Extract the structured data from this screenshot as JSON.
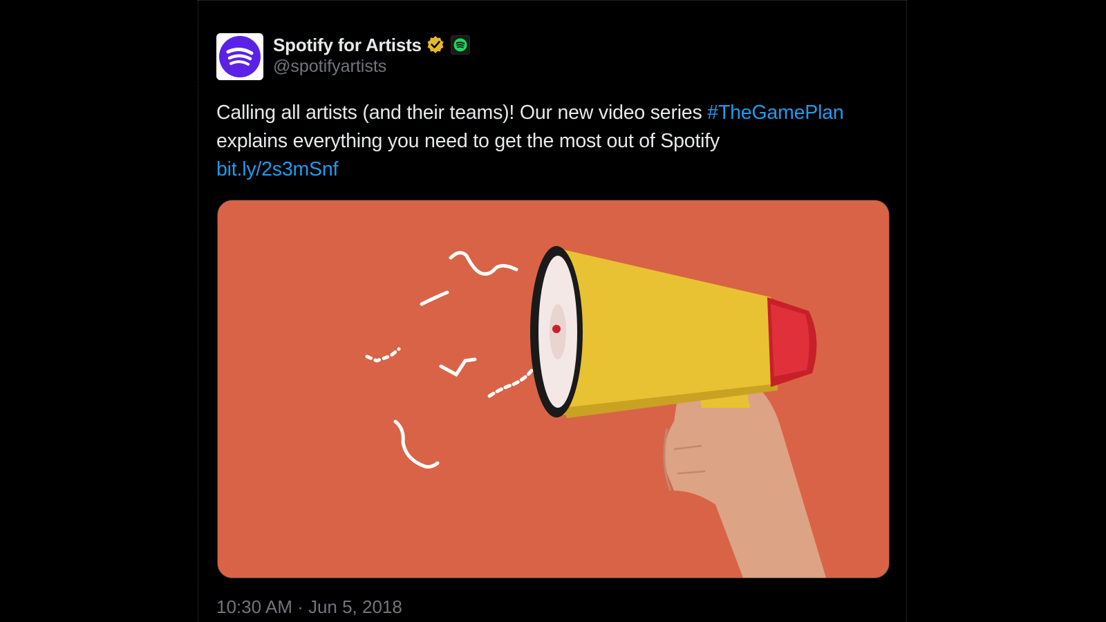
{
  "tweet": {
    "author": {
      "display_name": "Spotify for Artists",
      "handle": "@spotifyartists",
      "avatar_icon": "spotify-logo-icon",
      "verified_icon": "verified-badge-icon",
      "affiliate_icon": "spotify-affiliate-icon"
    },
    "text_before": "Calling all artists (and their teams)! Our new video series ",
    "hashtag": "#TheGamePlan",
    "text_after": " explains everything you need to get the most out of Spotify ",
    "link": "bit.ly/2s3mSnf",
    "timestamp": "10:30 AM · Jun 5, 2018",
    "media": {
      "description_icon": "megaphone-image",
      "background_color": "#d96346"
    }
  },
  "colors": {
    "background": "#000000",
    "text": "#e7e9ea",
    "muted": "#71767b",
    "link": "#1d9bf0",
    "verified_gold": "#e8b829",
    "spotify_purple": "#5b21e6",
    "spotify_green": "#1ed760"
  }
}
